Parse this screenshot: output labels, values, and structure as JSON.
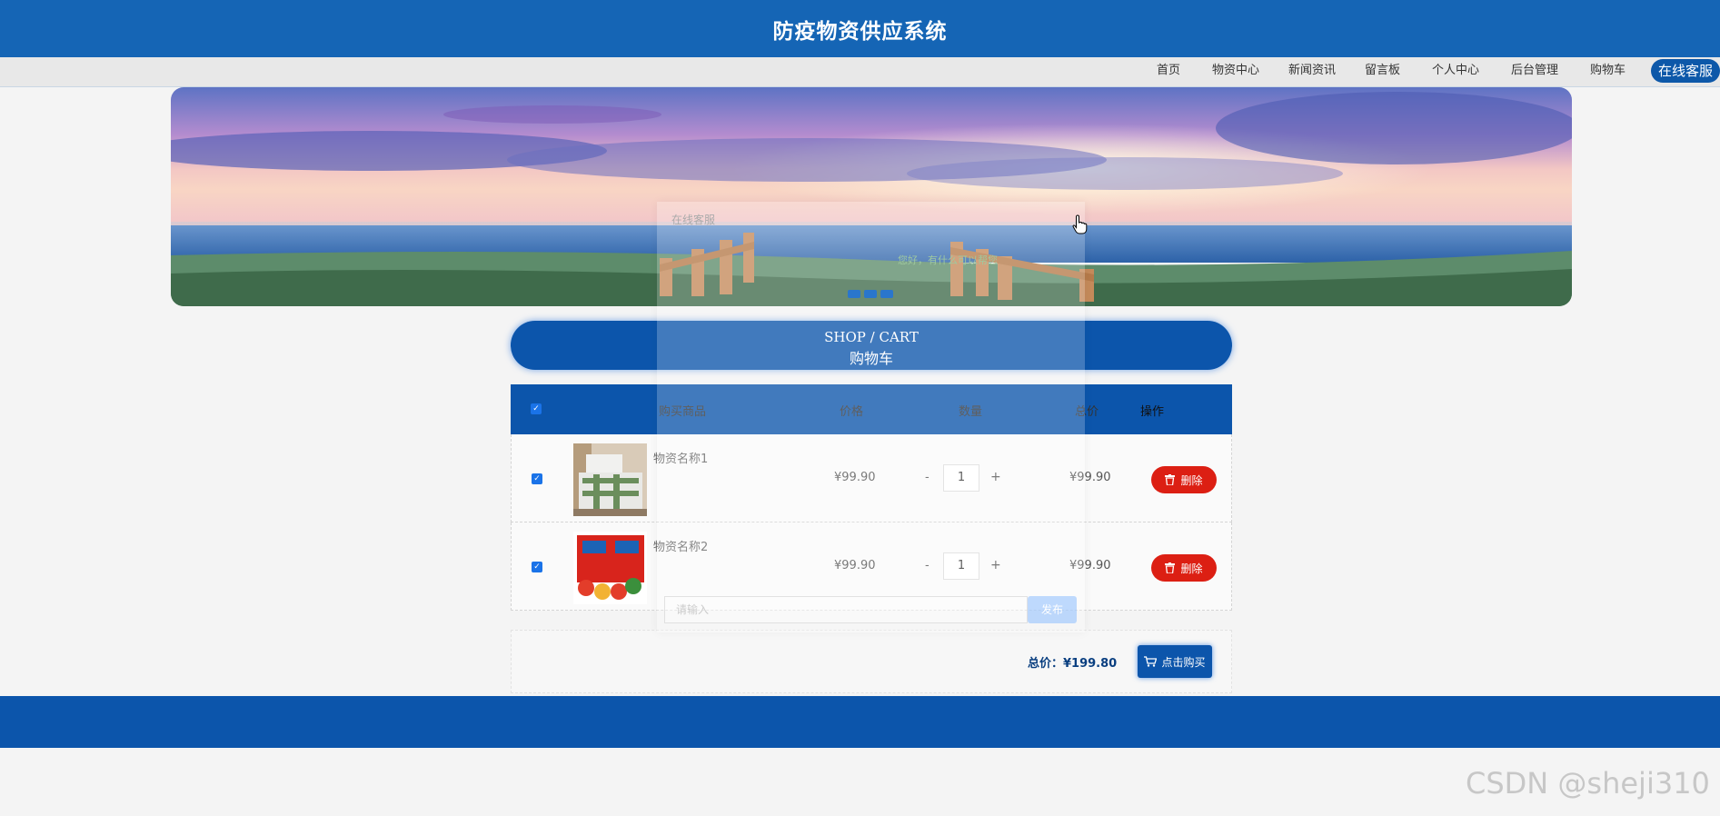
{
  "header": {
    "title": "防疫物资供应系统"
  },
  "nav": {
    "items": [
      "首页",
      "物资中心",
      "新闻资讯",
      "留言板",
      "个人中心",
      "后台管理",
      "购物车"
    ],
    "service": "在线客服"
  },
  "section": {
    "title_en": "SHOP / CART",
    "title_cn": "购物车"
  },
  "table": {
    "headers": {
      "product": "购买商品",
      "price": "价格",
      "quantity": "数量",
      "total": "总价",
      "action": "操作"
    },
    "rows": [
      {
        "name": "物资名称1",
        "price": "¥99.90",
        "quantity": "1",
        "total": "¥99.90",
        "delete_label": "删除",
        "checked": true
      },
      {
        "name": "物资名称2",
        "price": "¥99.90",
        "quantity": "1",
        "total": "¥99.90",
        "delete_label": "删除",
        "checked": true
      }
    ],
    "minus": "-",
    "plus": "+"
  },
  "summary": {
    "total_label": "总价：¥199.80",
    "buy_label": "点击购买"
  },
  "chat": {
    "title": "在线客服",
    "message": "您好，有什么可以帮您",
    "input_placeholder": "请输入",
    "send_label": "发布"
  },
  "watermark": "CSDN @sheji310",
  "colors": {
    "primary": "#1565b5",
    "dark_blue": "#0c55ab",
    "delete_red": "#dc1f13"
  }
}
